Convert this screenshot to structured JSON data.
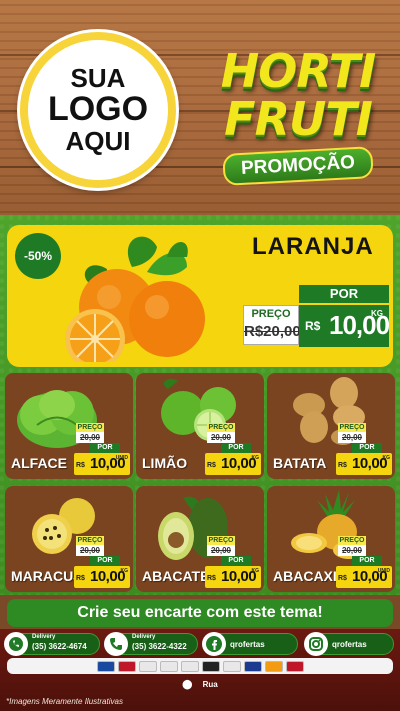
{
  "logo": {
    "line1": "SUA",
    "line2": "LOGO",
    "line3": "AQUI"
  },
  "brand": {
    "word1": "HORTI",
    "word2": "FRUTI",
    "subtitle": "PROMOÇÃO"
  },
  "featured": {
    "discount": "-50%",
    "name": "LARANJA",
    "old_label": "PREÇO",
    "old_price": "R$20,00",
    "por": "POR",
    "currency": "R$",
    "price": "10,00",
    "unit": "KG"
  },
  "products": [
    {
      "name": "ALFACE",
      "old_label": "PREÇO",
      "old_price": "20,00",
      "por": "POR",
      "currency": "R$",
      "price": "10,00",
      "unit": "UNID"
    },
    {
      "name": "LIMÃO",
      "old_label": "PREÇO",
      "old_price": "20,00",
      "por": "POR",
      "currency": "R$",
      "price": "10,00",
      "unit": "KG"
    },
    {
      "name": "BATATA",
      "old_label": "PREÇO",
      "old_price": "20,00",
      "por": "POR",
      "currency": "R$",
      "price": "10,00",
      "unit": "KG"
    },
    {
      "name": "MARACUJÁ",
      "old_label": "PREÇO",
      "old_price": "20,00",
      "por": "POR",
      "currency": "R$",
      "price": "10,00",
      "unit": "KG"
    },
    {
      "name": "ABACATE",
      "old_label": "PREÇO",
      "old_price": "20,00",
      "por": "POR",
      "currency": "R$",
      "price": "10,00",
      "unit": "KG"
    },
    {
      "name": "ABACAXI",
      "old_label": "PREÇO",
      "old_price": "20,00",
      "por": "POR",
      "currency": "R$",
      "price": "10,00",
      "unit": "UNID"
    }
  ],
  "cta": "Crie seu encarte com este tema!",
  "contacts": {
    "delivery_label": "Delivery",
    "whatsapp_phone": "(35) 3622-4674",
    "phone": "(35) 3622-4322",
    "facebook": "qrofertas",
    "instagram": "qrofertas"
  },
  "address": "Rua",
  "disclaimer": "*Imagens Meramente Ilustrativas",
  "payment_cards": [
    "#1a4aa0",
    "#c0162a",
    "#e8e8e8",
    "#e8e8e8",
    "#e8e8e8",
    "#222222",
    "#e8e8e8",
    "#1a3b8f",
    "#f39c12",
    "#c0162a"
  ]
}
